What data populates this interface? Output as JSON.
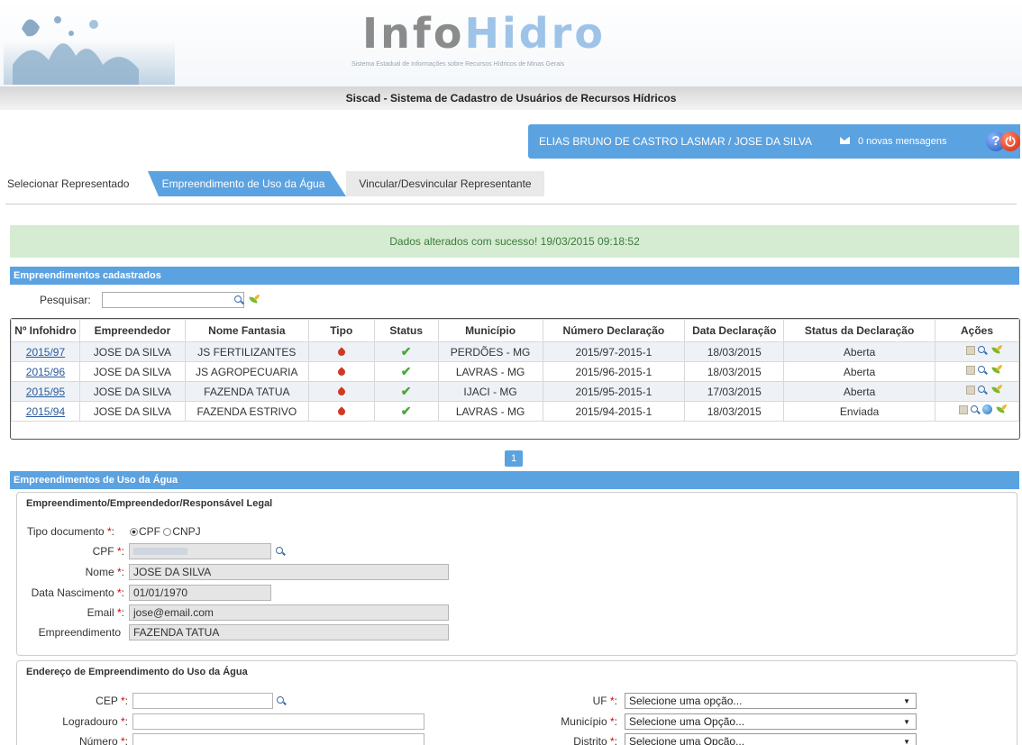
{
  "header": {
    "logo_left": "Info",
    "logo_right": "Hidro",
    "logo_subtitle": "Sistema Estadual de Informações sobre Recursos Hídricos de Minas Gerais",
    "system_title": "Siscad - Sistema de Cadastro de Usuários de Recursos Hídricos"
  },
  "userbar": {
    "user_name": "ELIAS BRUNO DE CASTRO LASMAR  /  JOSE DA SILVA",
    "messages": "0 novas mensagens",
    "help_label": "?"
  },
  "tabs": [
    {
      "label": "Selecionar Representado",
      "active": false
    },
    {
      "label": "Empreendimento de Uso da Água",
      "active": true
    },
    {
      "label": "Vincular/Desvincular Representante",
      "active": false
    }
  ],
  "success_message": "Dados alterados com sucesso! 19/03/2015 09:18:52",
  "list_section": {
    "title": "Empreendimentos cadastrados",
    "search_label": "Pesquisar:",
    "search_value": "",
    "columns": [
      "Nº Infohidro",
      "Empreendedor",
      "Nome Fantasia",
      "Tipo",
      "Status",
      "Município",
      "Número Declaração",
      "Data Declaração",
      "Status da Declaração",
      "Ações"
    ],
    "rows": [
      {
        "id": "2015/97",
        "empreendedor": "JOSE DA SILVA",
        "fantasia": "JS FERTILIZANTES",
        "municipio": "PERDÕES - MG",
        "numero": "2015/97-2015-1",
        "data": "18/03/2015",
        "status_decl": "Aberta"
      },
      {
        "id": "2015/96",
        "empreendedor": "JOSE DA SILVA",
        "fantasia": "JS AGROPECUARIA",
        "municipio": "LAVRAS - MG",
        "numero": "2015/96-2015-1",
        "data": "18/03/2015",
        "status_decl": "Aberta"
      },
      {
        "id": "2015/95",
        "empreendedor": "JOSE DA SILVA",
        "fantasia": "FAZENDA TATUA",
        "municipio": "IJACI - MG",
        "numero": "2015/95-2015-1",
        "data": "17/03/2015",
        "status_decl": "Aberta"
      },
      {
        "id": "2015/94",
        "empreendedor": "JOSE DA SILVA",
        "fantasia": "FAZENDA ESTRIVO",
        "municipio": "LAVRAS - MG",
        "numero": "2015/94-2015-1",
        "data": "18/03/2015",
        "status_decl": "Enviada"
      }
    ],
    "page": "1"
  },
  "form_section": {
    "title": "Empreendimentos de Uso da Água",
    "panel1_title": "Empreendimento/Empreendedor/Responsável Legal",
    "tipo_label": "Tipo documento",
    "cpf_option": "CPF",
    "cnpj_option": "CNPJ",
    "cpf_label": "CPF",
    "nome_label": "Nome",
    "nome_value": "JOSE DA SILVA",
    "nascimento_label": "Data Nascimento",
    "nascimento_value": "01/01/1970",
    "email_label": "Email",
    "email_value": "jose@email.com",
    "empreendimento_label": "Empreendimento",
    "empreendimento_value": "FAZENDA TATUA",
    "panel2_title": "Endereço de Empreendimento do Uso da Água",
    "cep_label": "CEP",
    "logradouro_label": "Logradouro",
    "numero_label": "Número",
    "uf_label": "UF",
    "uf_value": "Selecione uma opção...",
    "municipio_label": "Município",
    "municipio_value": "Selecione uma Opção...",
    "distrito_label": "Distrito",
    "distrito_value": "Selecione uma Opção..."
  },
  "colors": {
    "accent": "#5ba2e1",
    "success_bg": "#d6ecd2",
    "required": "#dd0000"
  }
}
